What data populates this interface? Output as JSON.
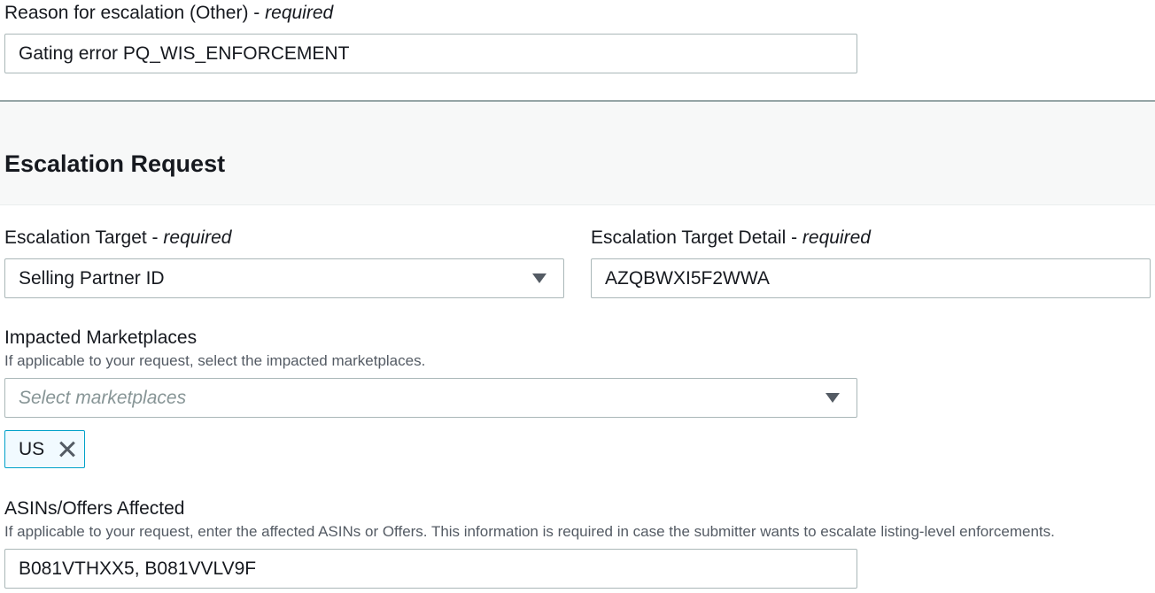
{
  "reason": {
    "label": "Reason for escalation (Other)",
    "required": "required",
    "value": "Gating error PQ_WIS_ENFORCEMENT"
  },
  "section": {
    "title": "Escalation Request"
  },
  "escalation_target": {
    "label": "Escalation Target",
    "required": "required",
    "selected": "Selling Partner ID",
    "caret_icon": "caret-down-icon"
  },
  "escalation_target_detail": {
    "label": "Escalation Target Detail",
    "required": "required",
    "value": "AZQBWXI5F2WWA"
  },
  "marketplaces": {
    "label": "Impacted Marketplaces",
    "hint": "If applicable to your request, select the impacted marketplaces.",
    "placeholder": "Select marketplaces",
    "caret_icon": "caret-down-icon",
    "tokens": [
      {
        "label": "US",
        "remove_icon": "close-icon"
      }
    ]
  },
  "asins": {
    "label": "ASINs/Offers Affected",
    "hint": "If applicable to your request, enter the affected ASINs or Offers. This information is required in case the submitter wants to escalate listing-level enforcements.",
    "value": "B081VTHXX5, B081VVLV9F"
  },
  "colors": {
    "token_border": "#00a1c9",
    "token_bg": "#f1faff",
    "field_border": "#aab7b8"
  }
}
